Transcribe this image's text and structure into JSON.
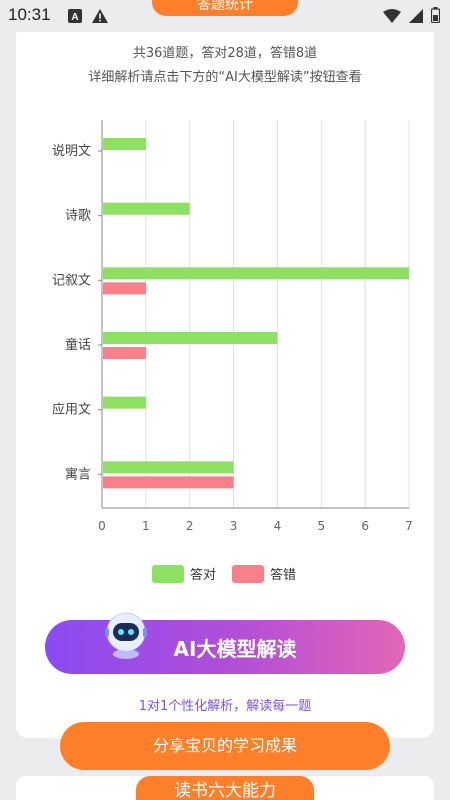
{
  "status_bar": {
    "time": "10:31",
    "left_icons": [
      "font-a-icon",
      "warning-icon"
    ],
    "right_icons": [
      "wifi-icon",
      "signal-icon",
      "battery-icon"
    ]
  },
  "header_tag": "答题统计",
  "summary": {
    "line1": "共36道题，答对28道，答错8道",
    "line2": "详细解析请点击下方的“AI大模型解读”按钮查看"
  },
  "colors": {
    "correct": "#8ee063",
    "wrong": "#f97f8a",
    "accent": "#ff7f2b",
    "ai_start": "#8a4bf3",
    "ai_end": "#e366b6"
  },
  "chart_data": {
    "type": "bar",
    "orientation": "horizontal",
    "categories": [
      "说明文",
      "诗歌",
      "记叙文",
      "童话",
      "应用文",
      "寓言"
    ],
    "series": [
      {
        "name": "答对",
        "values": [
          1,
          2,
          7,
          4,
          1,
          3
        ]
      },
      {
        "name": "答错",
        "values": [
          0,
          0,
          1,
          1,
          0,
          3
        ]
      }
    ],
    "xlim": [
      0,
      7
    ],
    "x_ticks": [
      "0",
      "1",
      "2",
      "3",
      "4",
      "5",
      "6",
      "7"
    ],
    "grid": true,
    "legend_placement": "bottom"
  },
  "legend": {
    "correct_label": "答对",
    "wrong_label": "答错"
  },
  "ai_button": {
    "label": "AI大模型解读",
    "subtext": "1对1个性化解析，解读每一题"
  },
  "share_button": {
    "label": "分享宝贝的学习成果"
  },
  "next_section_tag": "读书六大能力"
}
